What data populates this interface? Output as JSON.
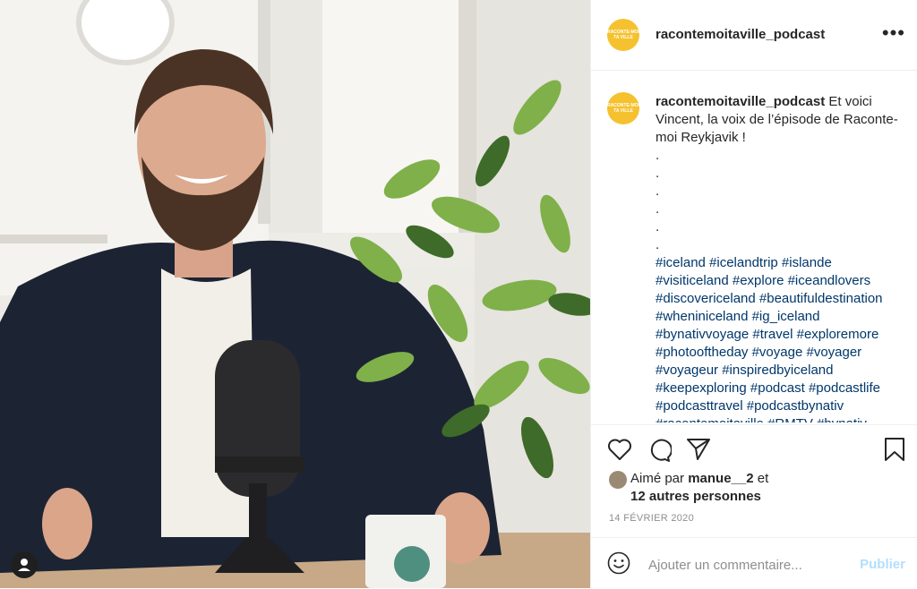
{
  "post": {
    "username": "racontemoitaville_podcast",
    "avatar_text": "RACONTE-MOI TA VILLE",
    "caption_text": "Et voici Vincent, la voix de l’épisode de Raconte-moi Reykjavik !",
    "caption_dots": [
      ".",
      ".",
      ".",
      ".",
      ".",
      "."
    ],
    "hashtags": [
      "#iceland #icelandtrip #islande",
      "#visiticeland #explore #iceandlovers",
      "#discovericeland #beautifuldestination",
      "#wheniniceland #ig_iceland",
      "#bynativvoyage #travel #exploremore",
      "#photooftheday #voyage #voyager",
      "#voyageur #inspiredbyiceland",
      "#keepexploring #podcast #podcastlife",
      "#podcasttravel #podcastbynativ",
      "#racontemoitaville #RMTV #bynativ"
    ],
    "likes_prefix": "Aimé par",
    "likes_user": "manue__2",
    "likes_and": "et",
    "likes_others": "12 autres personnes",
    "date": "14 FÉVRIER 2020",
    "comment_placeholder": "Ajouter un commentaire...",
    "publish_label": "Publier"
  },
  "icons": {
    "more": "more-options-icon",
    "like": "heart-icon",
    "comment": "comment-icon",
    "share": "paper-plane-icon",
    "save": "bookmark-icon",
    "emoji": "smiley-icon",
    "tagged": "user-tag-icon"
  },
  "colors": {
    "hashtag": "#00376b",
    "avatar_bg": "#f5c12e",
    "publish_disabled": "#b2dffc",
    "date": "#8e8e8e"
  }
}
